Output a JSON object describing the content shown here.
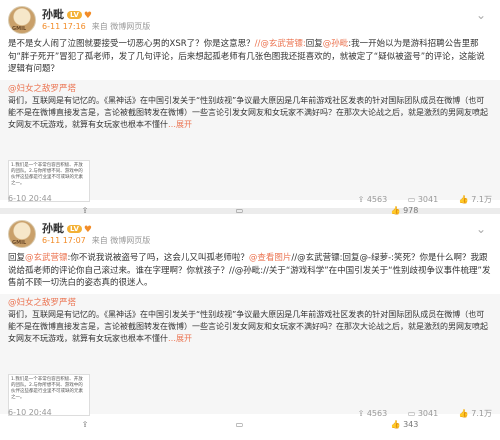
{
  "posts": [
    {
      "author": "孙毗",
      "vip": "LV",
      "heart": "♥",
      "time": "6-11 17:16",
      "source": "来自 微博网页版",
      "text_plain": "是不是女人闹了泣图就要接受一切恶心男的XSR了？你是这意思？",
      "mention1": "//@玄武营镖:",
      "text_2": "回复",
      "mention2": "@孙毗",
      "text_3": ":我一开始以为是游科招聘公告里那句“胖子死开”冒犯了孤老师，发了几句评论，后来想起孤老师有几张色图我还挺喜欢的，就被定了“疑似被盗号”的评论，这能说逻辑有问题？",
      "repost_author": "@妇女之敌罗严塔",
      "repost_text": "哥们，互联网是有记忆的。《黑神话》在中国引发关于“性别歧视”争议最大原因是几年前游戏社区发表的针对国际团队成员在微博（也可能不是在微博直接发言是，言论被截图转发在微博）一些言论引发女网友和女玩家不满好吗？在那次大论战之后，就是激烈的男网友喷起女网友不玩游戏，就算有女玩家也根本不懂什",
      "repost_more": "…展开",
      "thumb_text": "1.我们是一个非常包容且积极、开放的团队。2.与你所想不同、游戏中的伙伴这些都是行业里不可或缺的元素之一。",
      "repost_time": "6-10 20:44",
      "repost_shares": "4563",
      "repost_comments": "3041",
      "repost_likes": "7.1万",
      "actions": {
        "share": "",
        "comment": "",
        "like": "978"
      }
    },
    {
      "author": "孙毗",
      "vip": "LV",
      "heart": "♥",
      "time": "6-11 17:07",
      "source": "来自 微博网页版",
      "text_plain": "回复",
      "mention1": "@玄武营镖",
      "text_2": ":你不说我说被盗号了吗，这会儿又叫孤老师啦？",
      "mention2": "@查看图片",
      "text_3": "//@玄武营镖:回复@-绿萝-:笑死？你是什么啊？我跟说给孤老师的评论你自己滚过来。谁在字理啊？你就孩子？//@孙毗://关于“游戏科学”在中国引发关于“性别歧视争议事件梳理”发售前不顾一切洗白的姿态真的很迷人。",
      "repost_author": "@妇女之敌罗严塔",
      "repost_text": "哥们，互联网是有记忆的。《黑神话》在中国引发关于“性别歧视”争议最大原因是几年前游戏社区发表的针对国际团队成员在微博（也可能不是在微博直接发言是，言论被截图转发在微博）一些言论引发女网友和女玩家不满好吗？在那次大论战之后，就是激烈的男网友喷起女网友不玩游戏，就算有女玩家也根本不懂什",
      "repost_more": "…展开",
      "thumb_text": "1.我们是一个非常包容且积极、开放的团队。2.与你所想不同、游戏中的伙伴这些都是行业里不可或缺的元素之一。",
      "repost_time": "6-10 20:44",
      "repost_shares": "4563",
      "repost_comments": "3041",
      "repost_likes": "7.1万",
      "actions": {
        "share": "",
        "comment": "",
        "like": "343"
      }
    }
  ]
}
